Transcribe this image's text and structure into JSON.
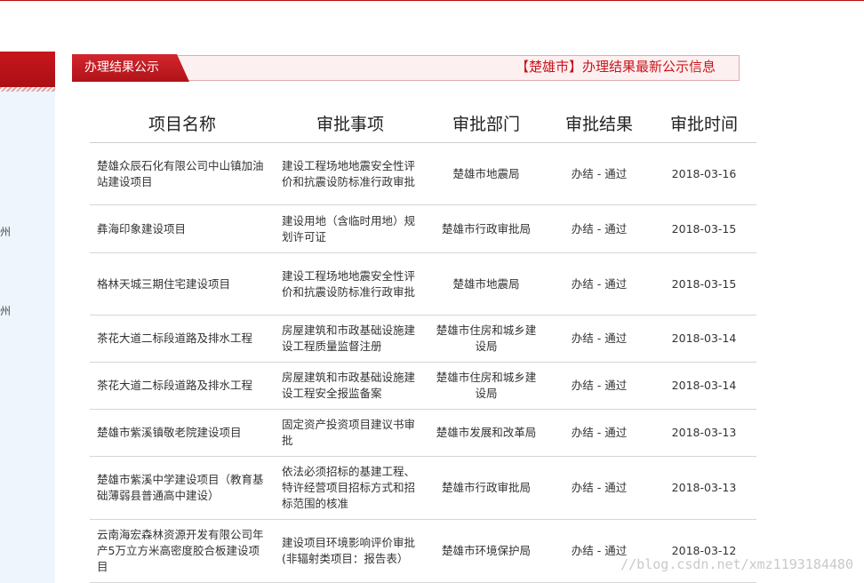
{
  "sidebar": {
    "chars": [
      "州",
      "州"
    ]
  },
  "section": {
    "tab_label": "办理结果公示",
    "right_text": "【楚雄市】办理结果最新公示信息"
  },
  "table": {
    "headers": [
      "项目名称",
      "审批事项",
      "审批部门",
      "审批结果",
      "审批时间"
    ],
    "rows": [
      {
        "name": "楚雄众辰石化有限公司中山镇加油站建设项目",
        "item": "建设工程场地地震安全性评价和抗震设防标准行政审批",
        "dept": "楚雄市地震局",
        "result": "办结 - 通过",
        "date": "2018-03-16"
      },
      {
        "name": "彝海印象建设项目",
        "item": "建设用地（含临时用地）规划许可证",
        "dept": "楚雄市行政审批局",
        "result": "办结 - 通过",
        "date": "2018-03-15"
      },
      {
        "name": "格林天城三期住宅建设项目",
        "item": "建设工程场地地震安全性评价和抗震设防标准行政审批",
        "dept": "楚雄市地震局",
        "result": "办结 - 通过",
        "date": "2018-03-15"
      },
      {
        "name": "茶花大道二标段道路及排水工程",
        "item": "房屋建筑和市政基础设施建设工程质量监督注册",
        "dept": "楚雄市住房和城乡建设局",
        "result": "办结 - 通过",
        "date": "2018-03-14"
      },
      {
        "name": "茶花大道二标段道路及排水工程",
        "item": "房屋建筑和市政基础设施建设工程安全报监备案",
        "dept": "楚雄市住房和城乡建设局",
        "result": "办结 - 通过",
        "date": "2018-03-14"
      },
      {
        "name": "楚雄市紫溪镇敬老院建设项目",
        "item": "固定资产投资项目建议书审批",
        "dept": "楚雄市发展和改革局",
        "result": "办结 - 通过",
        "date": "2018-03-13"
      },
      {
        "name": "楚雄市紫溪中学建设项目（教育基础薄弱县普通高中建设）",
        "item": "依法必须招标的基建工程、特许经营项目招标方式和招标范围的核准",
        "dept": "楚雄市行政审批局",
        "result": "办结 - 通过",
        "date": "2018-03-13"
      },
      {
        "name": "云南海宏森林资源开发有限公司年产5万立方米高密度胶合板建设项目",
        "item": "建设项目环境影响评价审批(非辐射类项目：报告表）",
        "dept": "楚雄市环境保护局",
        "result": "办结 - 通过",
        "date": "2018-03-12"
      }
    ]
  },
  "watermark": "//blog.csdn.net/xmz1193184480",
  "colors": {
    "accent": "#c8161d",
    "sidebar_bg": "#eef5fc",
    "header_bg": "#fdf0f0"
  }
}
